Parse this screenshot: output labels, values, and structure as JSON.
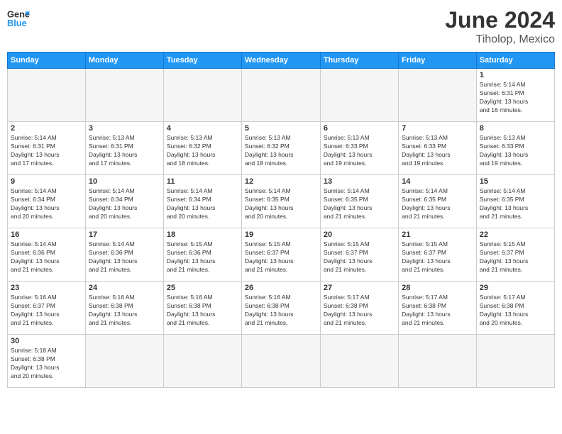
{
  "header": {
    "logo_general": "General",
    "logo_blue": "Blue",
    "title": "June 2024",
    "location": "Tiholop, Mexico"
  },
  "weekdays": [
    "Sunday",
    "Monday",
    "Tuesday",
    "Wednesday",
    "Thursday",
    "Friday",
    "Saturday"
  ],
  "days": [
    {
      "num": "",
      "info": "",
      "empty": true
    },
    {
      "num": "",
      "info": "",
      "empty": true
    },
    {
      "num": "",
      "info": "",
      "empty": true
    },
    {
      "num": "",
      "info": "",
      "empty": true
    },
    {
      "num": "",
      "info": "",
      "empty": true
    },
    {
      "num": "",
      "info": "",
      "empty": true
    },
    {
      "num": "1",
      "info": "Sunrise: 5:14 AM\nSunset: 6:31 PM\nDaylight: 13 hours\nand 16 minutes."
    },
    {
      "num": "2",
      "info": "Sunrise: 5:14 AM\nSunset: 6:31 PM\nDaylight: 13 hours\nand 17 minutes."
    },
    {
      "num": "3",
      "info": "Sunrise: 5:13 AM\nSunset: 6:31 PM\nDaylight: 13 hours\nand 17 minutes."
    },
    {
      "num": "4",
      "info": "Sunrise: 5:13 AM\nSunset: 6:32 PM\nDaylight: 13 hours\nand 18 minutes."
    },
    {
      "num": "5",
      "info": "Sunrise: 5:13 AM\nSunset: 6:32 PM\nDaylight: 13 hours\nand 18 minutes."
    },
    {
      "num": "6",
      "info": "Sunrise: 5:13 AM\nSunset: 6:33 PM\nDaylight: 13 hours\nand 19 minutes."
    },
    {
      "num": "7",
      "info": "Sunrise: 5:13 AM\nSunset: 6:33 PM\nDaylight: 13 hours\nand 19 minutes."
    },
    {
      "num": "8",
      "info": "Sunrise: 5:13 AM\nSunset: 6:33 PM\nDaylight: 13 hours\nand 19 minutes."
    },
    {
      "num": "9",
      "info": "Sunrise: 5:14 AM\nSunset: 6:34 PM\nDaylight: 13 hours\nand 20 minutes."
    },
    {
      "num": "10",
      "info": "Sunrise: 5:14 AM\nSunset: 6:34 PM\nDaylight: 13 hours\nand 20 minutes."
    },
    {
      "num": "11",
      "info": "Sunrise: 5:14 AM\nSunset: 6:34 PM\nDaylight: 13 hours\nand 20 minutes."
    },
    {
      "num": "12",
      "info": "Sunrise: 5:14 AM\nSunset: 6:35 PM\nDaylight: 13 hours\nand 20 minutes."
    },
    {
      "num": "13",
      "info": "Sunrise: 5:14 AM\nSunset: 6:35 PM\nDaylight: 13 hours\nand 21 minutes."
    },
    {
      "num": "14",
      "info": "Sunrise: 5:14 AM\nSunset: 6:35 PM\nDaylight: 13 hours\nand 21 minutes."
    },
    {
      "num": "15",
      "info": "Sunrise: 5:14 AM\nSunset: 6:35 PM\nDaylight: 13 hours\nand 21 minutes."
    },
    {
      "num": "16",
      "info": "Sunrise: 5:14 AM\nSunset: 6:36 PM\nDaylight: 13 hours\nand 21 minutes."
    },
    {
      "num": "17",
      "info": "Sunrise: 5:14 AM\nSunset: 6:36 PM\nDaylight: 13 hours\nand 21 minutes."
    },
    {
      "num": "18",
      "info": "Sunrise: 5:15 AM\nSunset: 6:36 PM\nDaylight: 13 hours\nand 21 minutes."
    },
    {
      "num": "19",
      "info": "Sunrise: 5:15 AM\nSunset: 6:37 PM\nDaylight: 13 hours\nand 21 minutes."
    },
    {
      "num": "20",
      "info": "Sunrise: 5:15 AM\nSunset: 6:37 PM\nDaylight: 13 hours\nand 21 minutes."
    },
    {
      "num": "21",
      "info": "Sunrise: 5:15 AM\nSunset: 6:37 PM\nDaylight: 13 hours\nand 21 minutes."
    },
    {
      "num": "22",
      "info": "Sunrise: 5:15 AM\nSunset: 6:37 PM\nDaylight: 13 hours\nand 21 minutes."
    },
    {
      "num": "23",
      "info": "Sunrise: 5:16 AM\nSunset: 6:37 PM\nDaylight: 13 hours\nand 21 minutes."
    },
    {
      "num": "24",
      "info": "Sunrise: 5:16 AM\nSunset: 6:38 PM\nDaylight: 13 hours\nand 21 minutes."
    },
    {
      "num": "25",
      "info": "Sunrise: 5:16 AM\nSunset: 6:38 PM\nDaylight: 13 hours\nand 21 minutes."
    },
    {
      "num": "26",
      "info": "Sunrise: 5:16 AM\nSunset: 6:38 PM\nDaylight: 13 hours\nand 21 minutes."
    },
    {
      "num": "27",
      "info": "Sunrise: 5:17 AM\nSunset: 6:38 PM\nDaylight: 13 hours\nand 21 minutes."
    },
    {
      "num": "28",
      "info": "Sunrise: 5:17 AM\nSunset: 6:38 PM\nDaylight: 13 hours\nand 21 minutes."
    },
    {
      "num": "29",
      "info": "Sunrise: 5:17 AM\nSunset: 6:38 PM\nDaylight: 13 hours\nand 20 minutes."
    },
    {
      "num": "30",
      "info": "Sunrise: 5:18 AM\nSunset: 6:38 PM\nDaylight: 13 hours\nand 20 minutes."
    },
    {
      "num": "",
      "info": "",
      "empty": true
    },
    {
      "num": "",
      "info": "",
      "empty": true
    },
    {
      "num": "",
      "info": "",
      "empty": true
    },
    {
      "num": "",
      "info": "",
      "empty": true
    },
    {
      "num": "",
      "info": "",
      "empty": true
    },
    {
      "num": "",
      "info": "",
      "empty": true
    }
  ]
}
